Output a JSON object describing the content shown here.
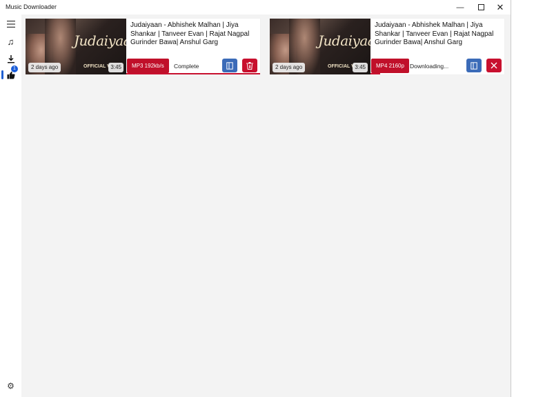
{
  "window": {
    "title": "Music Downloader",
    "controls": [
      "minimize",
      "maximize",
      "close"
    ]
  },
  "sidebar": {
    "items": [
      {
        "icon": "hamburger-menu-icon"
      },
      {
        "icon": "music-note-icon"
      },
      {
        "icon": "download-icon",
        "badge": "1",
        "selected": true
      },
      {
        "icon": "thumbs-up-icon"
      },
      {
        "icon": "gear-icon"
      }
    ]
  },
  "downloads": [
    {
      "title": "Judaiyaan - Abhishek Malhan | Jiya Shankar | Tanveer Evan | Rajat Nagpal Gurinder Bawa| Anshul Garg",
      "thumbnail_text": "Judaiyaan",
      "thumbnail_subtext": "OFFICIAL V",
      "age": "2 days ago",
      "duration": "3:45",
      "format": "MP3 192kb/s",
      "status": "Complete",
      "progress": 1.0,
      "actions": [
        "open-folder",
        "delete"
      ]
    },
    {
      "title": "Judaiyaan - Abhishek Malhan | Jiya Shankar | Tanveer Evan | Rajat Nagpal Gurinder Bawa| Anshul Garg",
      "thumbnail_text": "Judaiyaan",
      "thumbnail_subtext": "OFFICIAL V",
      "age": "2 days ago",
      "duration": "3:45",
      "format": "MP4 2160p",
      "status": "Downloading...",
      "progress": 0.07,
      "actions": [
        "open-folder",
        "cancel"
      ]
    }
  ],
  "colors": {
    "accent_red": "#c8102e",
    "accent_blue": "#3b6bb8",
    "selected_indicator": "#1f5fd1"
  }
}
